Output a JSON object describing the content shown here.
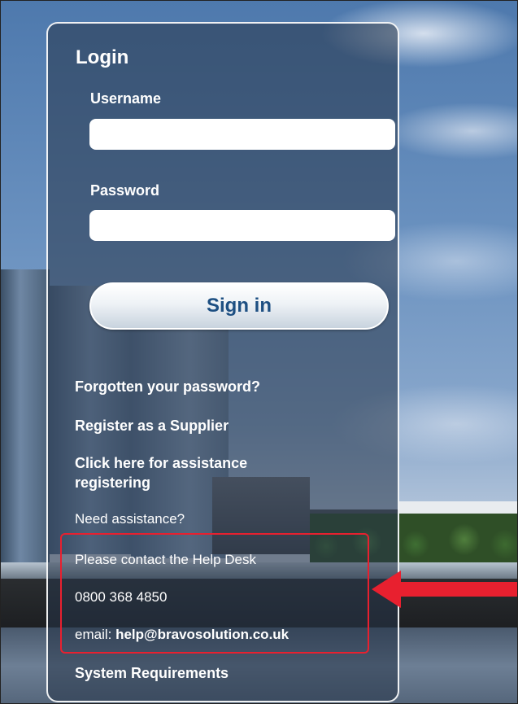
{
  "login": {
    "title": "Login",
    "username_label": "Username",
    "username_value": "",
    "password_label": "Password",
    "password_value": "",
    "sign_in_label": "Sign in"
  },
  "links": {
    "forgot_password": "Forgotten your password?",
    "register_supplier": "Register as a Supplier",
    "assistance_registering": "Click here for assistance registering",
    "system_requirements": "System Requirements"
  },
  "help": {
    "need_assistance": "Need assistance?",
    "contact_help_desk": "Please contact the Help Desk",
    "phone": "0800 368 4850",
    "email_prefix": "email:",
    "email_address": "help@bravosolution.co.uk"
  },
  "annotation": {
    "highlight_color": "#e8202f",
    "arrow_icon": "left-arrow-icon"
  }
}
